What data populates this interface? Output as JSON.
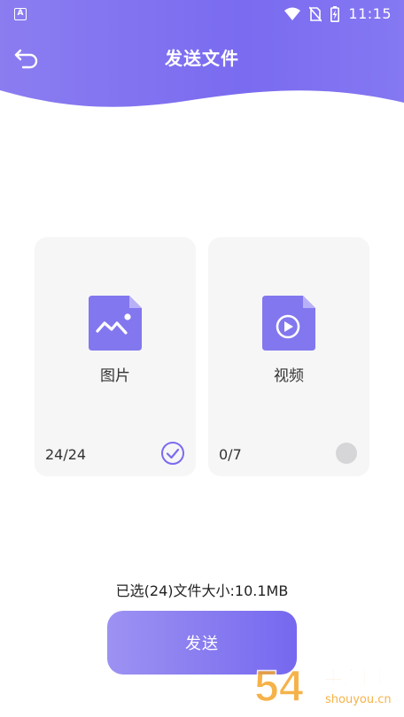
{
  "status_bar": {
    "app_icon_letter": "A",
    "time": "11:15",
    "icons": [
      "wifi-icon",
      "no-sim-icon",
      "battery-charging-icon"
    ]
  },
  "header": {
    "title": "发送文件",
    "back_icon": "back-arrow-icon"
  },
  "cards": [
    {
      "label": "图片",
      "count": "24/24",
      "icon": "image-file-icon",
      "selected": true
    },
    {
      "label": "视频",
      "count": "0/7",
      "icon": "video-file-icon",
      "selected": false
    }
  ],
  "summary": "已选(24)文件大小:10.1MB",
  "send_button": {
    "label": "发送"
  },
  "watermark": {
    "text": "手游网",
    "sub": "shouyou.cn",
    "digits": "54"
  },
  "colors": {
    "accent": "#7a6bf0",
    "card_bg": "#f6f6f7",
    "watermark": "#f4a52a"
  }
}
